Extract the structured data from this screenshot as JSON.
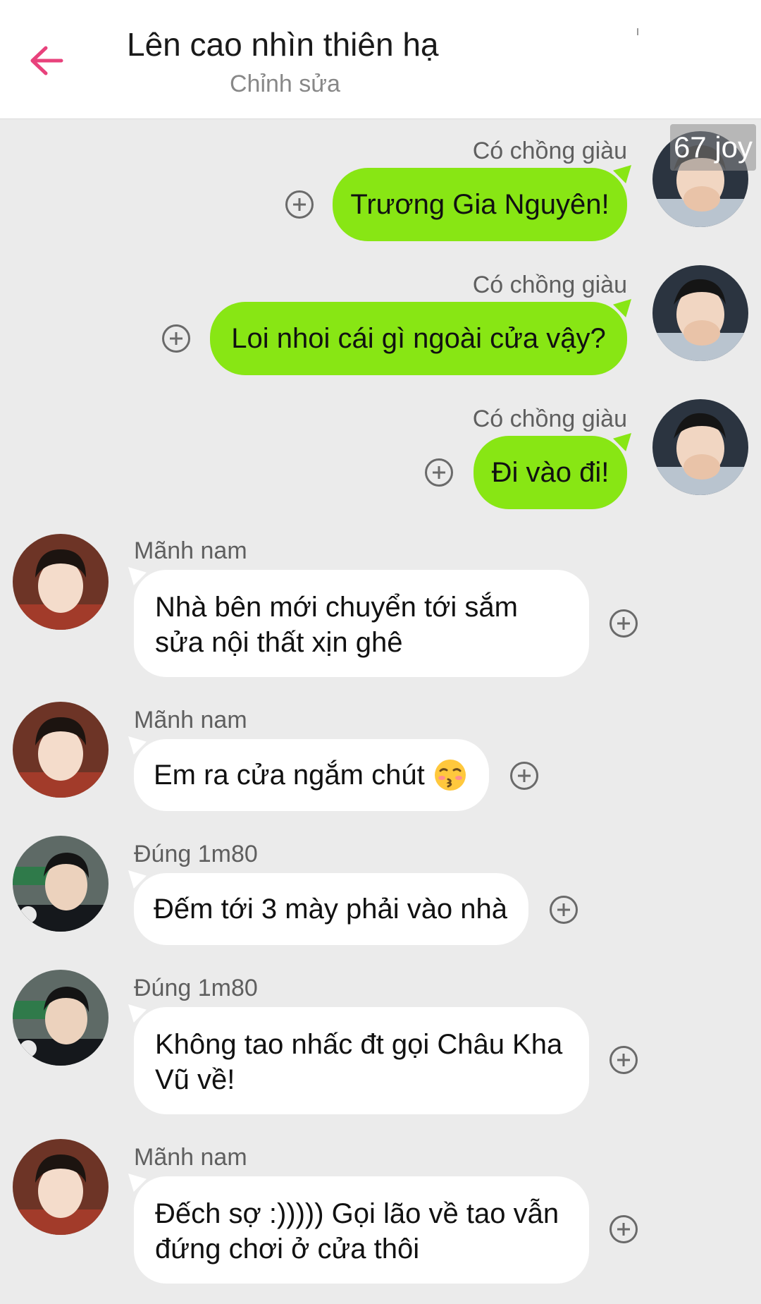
{
  "header": {
    "title": "Lên cao nhìn thiên hạ",
    "subtitle": "Chỉnh sửa"
  },
  "watermark": "67 joy",
  "messages": [
    {
      "sender": "Có chồng giàu",
      "text": "Trương Gia Nguyên!",
      "side": "right"
    },
    {
      "sender": "Có chồng giàu",
      "text": "Loi nhoi cái gì ngoài cửa vậy?",
      "side": "right"
    },
    {
      "sender": "Có chồng giàu",
      "text": "Đi vào đi!",
      "side": "right"
    },
    {
      "sender": "Mãnh nam",
      "lines": [
        "Nhà bên mới chuyển tới sắm",
        "sửa nội thất xịn ghê"
      ],
      "side": "left"
    },
    {
      "sender": "Mãnh nam",
      "text": "Em ra cửa ngắm chút",
      "emoji": "kissing-face-emoji",
      "side": "left"
    },
    {
      "sender": "Đúng 1m80",
      "text": "Đếm tới 3 mày phải vào nhà",
      "side": "left"
    },
    {
      "sender": "Đúng 1m80",
      "lines": [
        "Không tao nhấc đt gọi Châu Kha",
        "Vũ về!"
      ],
      "side": "left"
    },
    {
      "sender": "Mãnh nam",
      "lines": [
        "Đếch sợ :))))) Gọi lão về tao vẫn",
        "đứng chơi ở cửa thôi"
      ],
      "side": "left"
    }
  ],
  "colors": {
    "accent": "#e8427c",
    "outgoing_bubble": "#88e614",
    "incoming_bubble": "#ffffff",
    "background": "#ebebeb"
  },
  "icons": {
    "back": "back-arrow-icon",
    "add_reaction": "plus-circle-icon"
  }
}
